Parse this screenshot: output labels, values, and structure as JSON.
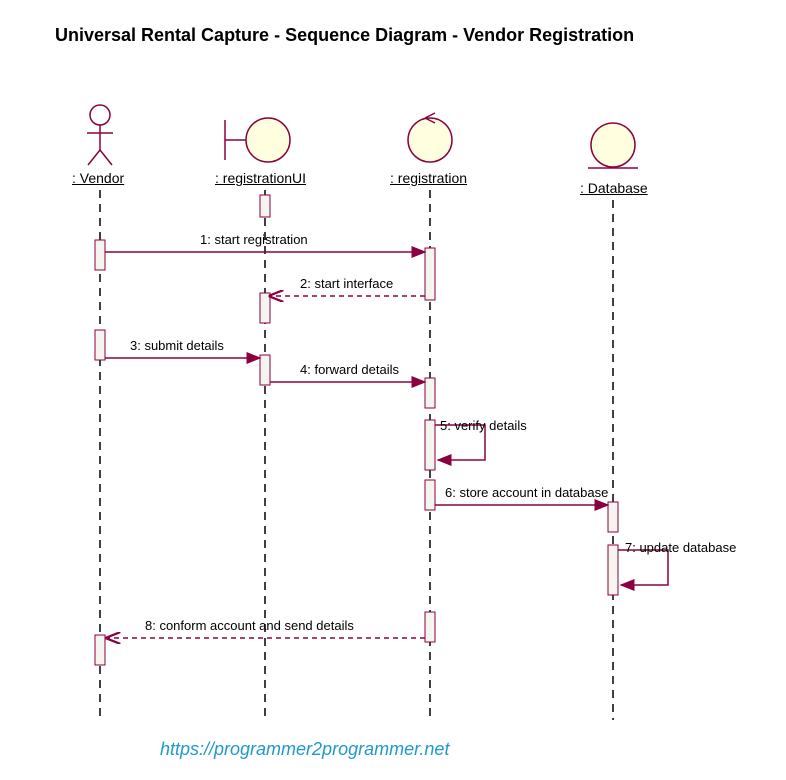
{
  "title": "Universal Rental Capture - Sequence Diagram - Vendor Registration",
  "lifelines": {
    "vendor": ": Vendor",
    "registrationUI": ": registrationUI",
    "registration": ": registration",
    "database": ": Database"
  },
  "messages": {
    "m1": "1: start registration",
    "m2": "2: start interface",
    "m3": "3: submit details",
    "m4": "4: forward details",
    "m5": "5: verify details",
    "m6": "6: store account in database",
    "m7": "7: update database",
    "m8": "8: conform account and send details"
  },
  "watermark": "https://programmer2programmer.net",
  "colors": {
    "line": "#8B0040",
    "fill": "#FFFFE0",
    "actbox": "#F5F5F0"
  }
}
